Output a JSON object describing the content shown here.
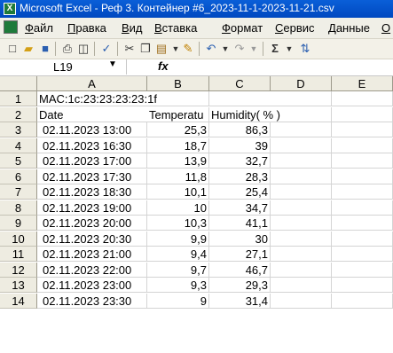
{
  "window": {
    "title": "Microsoft Excel - Реф 3. Контейнер #6_2023-11-1-2023-11-21.csv"
  },
  "menu": [
    "Файл",
    "Правка",
    "Вид",
    "Вставка",
    "Формат",
    "Сервис",
    "Данные",
    "О"
  ],
  "name_box": {
    "value": "L19"
  },
  "formula_bar": {
    "fx_label": "fx",
    "value": ""
  },
  "columns": [
    "A",
    "B",
    "C",
    "D",
    "E"
  ],
  "rows": [
    {
      "n": "1",
      "a": "MAC:1c:23:23:23:23:1f",
      "b": "",
      "c": ""
    },
    {
      "n": "2",
      "a": "Date",
      "b": "Temperatu",
      "c": "Humidity( % )"
    },
    {
      "n": "3",
      "a": "02.11.2023 13:00",
      "b": "25,3",
      "c": "86,3"
    },
    {
      "n": "4",
      "a": "02.11.2023 16:30",
      "b": "18,7",
      "c": "39"
    },
    {
      "n": "5",
      "a": "02.11.2023 17:00",
      "b": "13,9",
      "c": "32,7"
    },
    {
      "n": "6",
      "a": "02.11.2023 17:30",
      "b": "11,8",
      "c": "28,3"
    },
    {
      "n": "7",
      "a": "02.11.2023 18:30",
      "b": "10,1",
      "c": "25,4"
    },
    {
      "n": "8",
      "a": "02.11.2023 19:00",
      "b": "10",
      "c": "34,7"
    },
    {
      "n": "9",
      "a": "02.11.2023 20:00",
      "b": "10,3",
      "c": "41,1"
    },
    {
      "n": "10",
      "a": "02.11.2023 20:30",
      "b": "9,9",
      "c": "30"
    },
    {
      "n": "11",
      "a": "02.11.2023 21:00",
      "b": "9,4",
      "c": "27,1"
    },
    {
      "n": "12",
      "a": "02.11.2023 22:00",
      "b": "9,7",
      "c": "46,7"
    },
    {
      "n": "13",
      "a": "02.11.2023 23:00",
      "b": "9,3",
      "c": "29,3"
    },
    {
      "n": "14",
      "a": "02.11.2023 23:30",
      "b": "9",
      "c": "31,4"
    }
  ]
}
